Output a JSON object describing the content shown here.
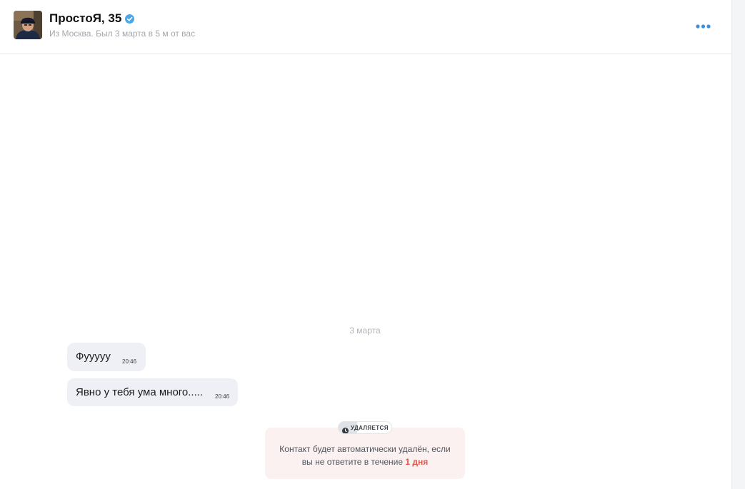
{
  "header": {
    "name": "ПростоЯ, 35",
    "subtitle": "Из Москва. Был 3 марта в 5 м от вас",
    "avatar_icon": "avatar-photo",
    "verified_icon": "verified-check-icon",
    "verified_color": "#4aa8e8",
    "more_icon": "more-dots-icon",
    "more_color": "#3b8fdc"
  },
  "chat": {
    "date_separator": "3 марта",
    "messages": [
      {
        "text": "Фууууу",
        "time": "20:46"
      },
      {
        "text": "Явно у тебя ума много.....",
        "time": "20:46"
      }
    ]
  },
  "deletion_notice": {
    "badge_label": "УДАЛЯЕТСЯ",
    "badge_icon": "clock-icon",
    "progress": 0.35,
    "text_line1": "Контакт будет автоматически удалён, если",
    "text_line2_prefix": "вы не ответите в течение",
    "text_highlight": "1 дня",
    "highlight_color": "#e0534a"
  }
}
